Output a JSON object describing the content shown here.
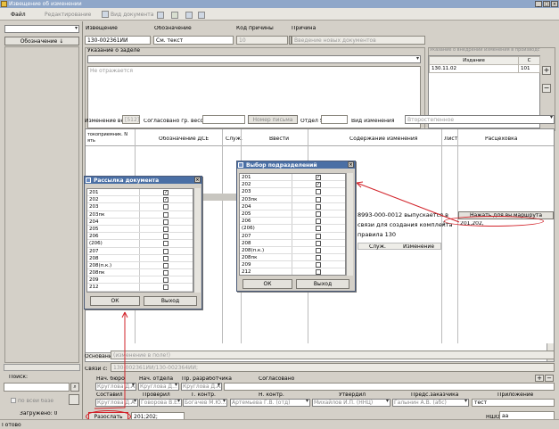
{
  "window": {
    "title": "Извещение об изменении"
  },
  "menu": {
    "file": "Файл",
    "edit": "Редактирование",
    "doc_view": "Вид документа"
  },
  "left_panel": {
    "designation_button": "Обозначение",
    "search_label": "Поиск:",
    "by_tree_label": "по всей базе",
    "loaded_label": "Загружено: 0"
  },
  "header": {
    "notice_label": "Извещение",
    "designation_label": "Обозначение",
    "reason_code_label": "Код причины",
    "reason_label": "Причина",
    "notice_value": "130-002361ИИ",
    "designation_value": "См. текст",
    "reason_code_value": "10",
    "reason_value": "Введение новых документов"
  },
  "backlog": {
    "title": "Указание о заделе",
    "placeholder": "Не отражается"
  },
  "changes_panel": {
    "title": "Указание о внедрении изменения в производство",
    "col_issue": "Издание",
    "col_c": "С",
    "row_date": "130.11.02",
    "row_c": "101"
  },
  "weight_row": {
    "weight_change_label": "Изменение веса",
    "weight_value": "[512]",
    "agreed_label": "Согласовано гр. весов",
    "letter_button": "Номер письма",
    "dept_label": "Отдел 5",
    "change_type_label": "Вид изменения",
    "change_type_value": "Второстепенное"
  },
  "changes_table": {
    "cols": [
      "токоприемник. N ять",
      "Обозначение ДСЕ",
      "Служ.",
      "Ввести",
      "Содержание изменения",
      "Лист",
      "Расцеховка"
    ],
    "content_text": [
      "8993-000-0012 выпускается в",
      "связи для создания комплекта",
      "правила 130"
    ],
    "subcols": [
      "Служ.",
      "Изменение"
    ],
    "route_button": "Нажать для вн.маршрута",
    "route_row_num": "1",
    "route_row_value": "201,202,"
  },
  "dialog_distribution": {
    "title": "Рассылка документа",
    "items": [
      {
        "label": "201",
        "checked": true
      },
      {
        "label": "202",
        "checked": true
      },
      {
        "label": "203",
        "checked": false
      },
      {
        "label": "203пк",
        "checked": false
      },
      {
        "label": "204",
        "checked": false
      },
      {
        "label": "205",
        "checked": false
      },
      {
        "label": "206",
        "checked": false
      },
      {
        "label": "(206)",
        "checked": false
      },
      {
        "label": "207",
        "checked": false
      },
      {
        "label": "208",
        "checked": false
      },
      {
        "label": "208(п.к.)",
        "checked": false
      },
      {
        "label": "208пк",
        "checked": false
      },
      {
        "label": "209",
        "checked": false
      },
      {
        "label": "212",
        "checked": false
      }
    ],
    "ok": "ОК",
    "exit": "Выход"
  },
  "dialog_departments": {
    "title": "Выбор подразделений",
    "items": [
      {
        "label": "201",
        "checked": true
      },
      {
        "label": "202",
        "checked": true
      },
      {
        "label": "203",
        "checked": false
      },
      {
        "label": "203пк",
        "checked": false
      },
      {
        "label": "204",
        "checked": false
      },
      {
        "label": "205",
        "checked": false
      },
      {
        "label": "206",
        "checked": false
      },
      {
        "label": "(206)",
        "checked": false
      },
      {
        "label": "207",
        "checked": false
      },
      {
        "label": "208",
        "checked": false
      },
      {
        "label": "208(п.к.)",
        "checked": false
      },
      {
        "label": "208пк",
        "checked": false
      },
      {
        "label": "209",
        "checked": false
      },
      {
        "label": "212",
        "checked": false
      }
    ],
    "ok": "ОК",
    "exit": "Выход"
  },
  "bottom": {
    "basis_label": "Основание:",
    "basis_value": "(изменение в поле!)",
    "links_label": "Связи с:",
    "links_value": "130-002361ИИ/130-002364ИИ;",
    "sign_labels": [
      "Нач. бюро",
      "Нач. отдела",
      "Пр. разработчика",
      "Согласовано"
    ],
    "sign_values": [
      "Круглова Д.А.",
      "Круглова Д...",
      "Круглова Д.А.",
      ""
    ],
    "sign_labels2": [
      "Составил",
      "Проверил",
      "Т. контр.",
      "Н. контр.",
      "Утвердил",
      "Предс.заказчика",
      "Приложение"
    ],
    "sign_values2": [
      "Круглова Д.А.",
      "Говорова В.Е...",
      "Богачев М.Ю...",
      "Артемьева Г.В. (отд)",
      "Михайлов И.П. (ННЦ)",
      "Галынин А.В. (абс)",
      "тест"
    ],
    "send_button": "Разослать",
    "send_value": "201;202;",
    "nsh_label": "НШО",
    "nsh_value": "аа"
  },
  "status": {
    "text": "Готово"
  }
}
